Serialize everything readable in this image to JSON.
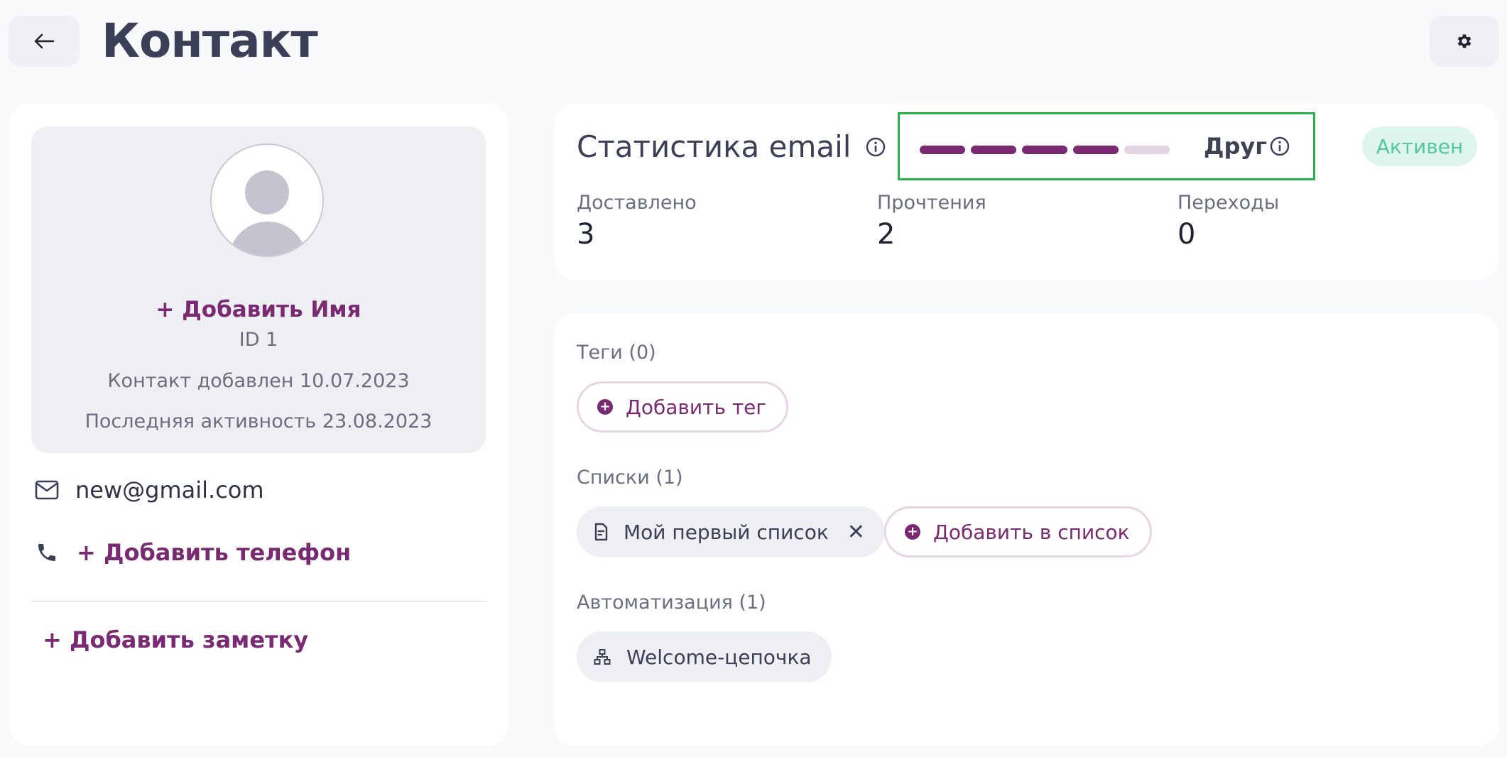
{
  "header": {
    "title": "Контакт",
    "back_icon": "arrow-left-icon",
    "settings_icon": "gear-icon"
  },
  "profile": {
    "add_name": "+ Добавить Имя",
    "id_label": "ID 1",
    "added": "Контакт добавлен 10.07.2023",
    "last_activity": "Последняя активность 23.08.2023",
    "email": "new@gmail.com",
    "add_phone": "+ Добавить телефон",
    "add_note": "+ Добавить заметку"
  },
  "stats": {
    "title": "Статистика email",
    "rating": {
      "label": "Друг",
      "level": 4,
      "max": 5
    },
    "status": "Активен",
    "items": [
      {
        "label": "Доставлено",
        "value": "3"
      },
      {
        "label": "Прочтения",
        "value": "2"
      },
      {
        "label": "Переходы",
        "value": "0"
      }
    ]
  },
  "tags": {
    "label": "Теги (0)",
    "add_button": "Добавить тег"
  },
  "lists": {
    "label": "Списки (1)",
    "items": [
      {
        "name": "Мой первый список"
      }
    ],
    "add_button": "Добавить в список"
  },
  "automation": {
    "label": "Автоматизация (1)",
    "items": [
      {
        "name": "Welcome-цепочка"
      }
    ]
  },
  "colors": {
    "accent": "#7a2a72",
    "accent_light": "#e5d4e3",
    "status_bg": "#def5ed",
    "status_text": "#54c79e",
    "highlight": "#27b14a"
  }
}
